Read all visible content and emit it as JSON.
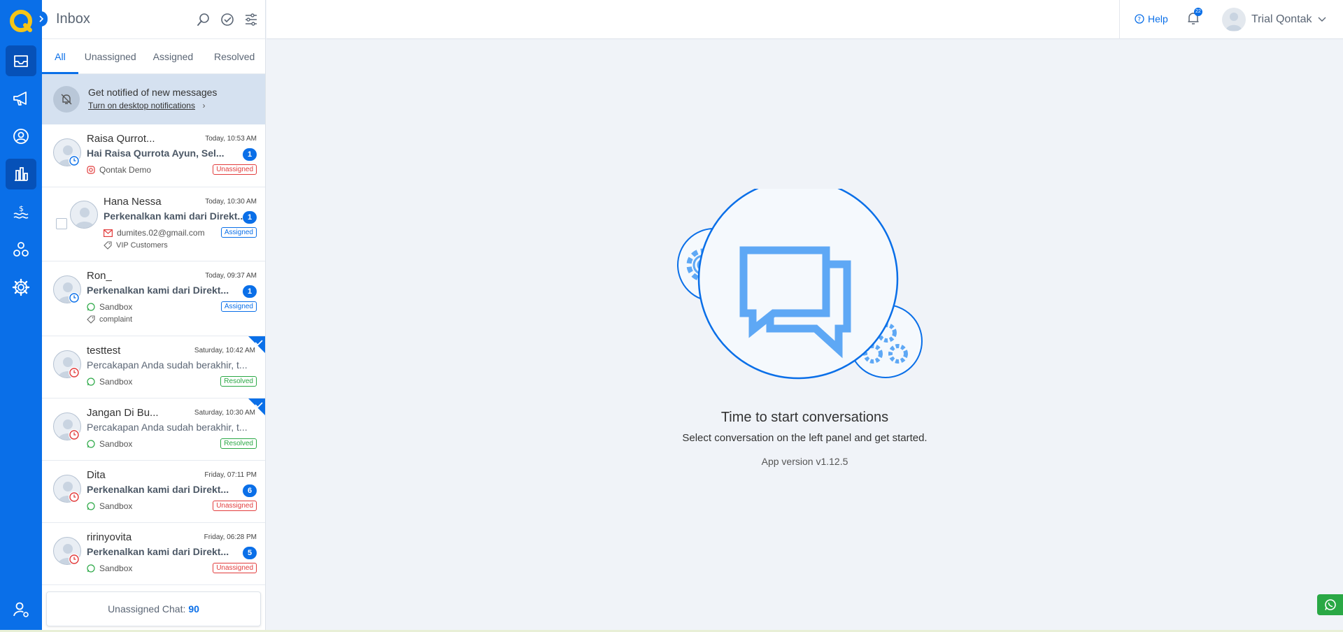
{
  "app": {
    "title": "Inbox",
    "colors": {
      "brand": "#0a6fe8",
      "rail_active": "#0651b8",
      "logo": "#f5c518",
      "unassigned": "#e23c3c",
      "resolved": "#2aa845"
    }
  },
  "rail": {
    "items": [
      {
        "icon": "inbox-icon",
        "active": true
      },
      {
        "icon": "megaphone-icon",
        "active": false
      },
      {
        "icon": "contact-icon",
        "active": false
      },
      {
        "icon": "chart-icon",
        "active": false
      },
      {
        "icon": "dollar-icon",
        "active": false
      },
      {
        "icon": "integrations-icon",
        "active": false
      },
      {
        "icon": "gear-icon",
        "active": false
      }
    ],
    "bottom_icon": "user-settings-icon"
  },
  "panel": {
    "title": "Inbox",
    "tabs": [
      {
        "label": "All",
        "active": true
      },
      {
        "label": "Unassigned",
        "active": false
      },
      {
        "label": "Assigned",
        "active": false
      },
      {
        "label": "Resolved",
        "active": false
      }
    ],
    "notification": {
      "title": "Get notified of new messages",
      "link": "Turn on desktop notifications"
    },
    "conversations": [
      {
        "name": "Raisa Qurrot...",
        "time": "Today, 10:53 AM",
        "message": "Hai Raisa Qurrota Ayun, Sel...",
        "bold": true,
        "count": "1",
        "channel": "Qontak Demo",
        "channel_icon": "instagram-icon",
        "status": "Unassigned",
        "status_key": "unassigned"
      },
      {
        "name": "Hana Nessa",
        "time": "Today, 10:30 AM",
        "message": "Perkenalkan kami dari Direkt...",
        "bold": true,
        "count": "1",
        "channel": "dumites.02@gmail.com",
        "channel_icon": "email-icon",
        "tag": "VIP Customers",
        "status": "Assigned",
        "status_key": "assigned"
      },
      {
        "name": "Ron_",
        "time": "Today, 09:37 AM",
        "message": "Perkenalkan kami dari Direkt...",
        "bold": true,
        "count": "1",
        "channel": "Sandbox",
        "channel_icon": "whatsapp-icon",
        "tag": "complaint",
        "status": "Assigned",
        "status_key": "assigned"
      },
      {
        "name": "testtest",
        "time": "Saturday, 10:42 AM",
        "message": "Percakapan Anda sudah berakhir, t...",
        "bold": false,
        "channel": "Sandbox",
        "channel_icon": "whatsapp-icon",
        "status": "Resolved",
        "status_key": "resolved",
        "checked": true
      },
      {
        "name": "Jangan Di Bu...",
        "time": "Saturday, 10:30 AM",
        "message": "Percakapan Anda sudah berakhir, t...",
        "bold": false,
        "channel": "Sandbox",
        "channel_icon": "whatsapp-icon",
        "status": "Resolved",
        "status_key": "resolved",
        "checked": true
      },
      {
        "name": "Dita",
        "time": "Friday, 07:11 PM",
        "message": "Perkenalkan kami dari Direkt...",
        "bold": true,
        "count": "6",
        "channel": "Sandbox",
        "channel_icon": "whatsapp-icon",
        "status": "Unassigned",
        "status_key": "unassigned"
      },
      {
        "name": "ririnyovita",
        "time": "Friday, 06:28 PM",
        "message": "Perkenalkan kami dari Direkt...",
        "bold": true,
        "count": "5",
        "channel": "Sandbox",
        "channel_icon": "whatsapp-icon",
        "status": "Unassigned",
        "status_key": "unassigned"
      }
    ],
    "footer": {
      "label": "Unassigned Chat:",
      "count": "90"
    }
  },
  "topbar": {
    "help": "Help",
    "notification_count": "22",
    "user_name": "Trial Qontak"
  },
  "empty_state": {
    "title": "Time to start conversations",
    "subtitle": "Select conversation on the left panel and get started.",
    "version": "App version v1.12.5"
  }
}
